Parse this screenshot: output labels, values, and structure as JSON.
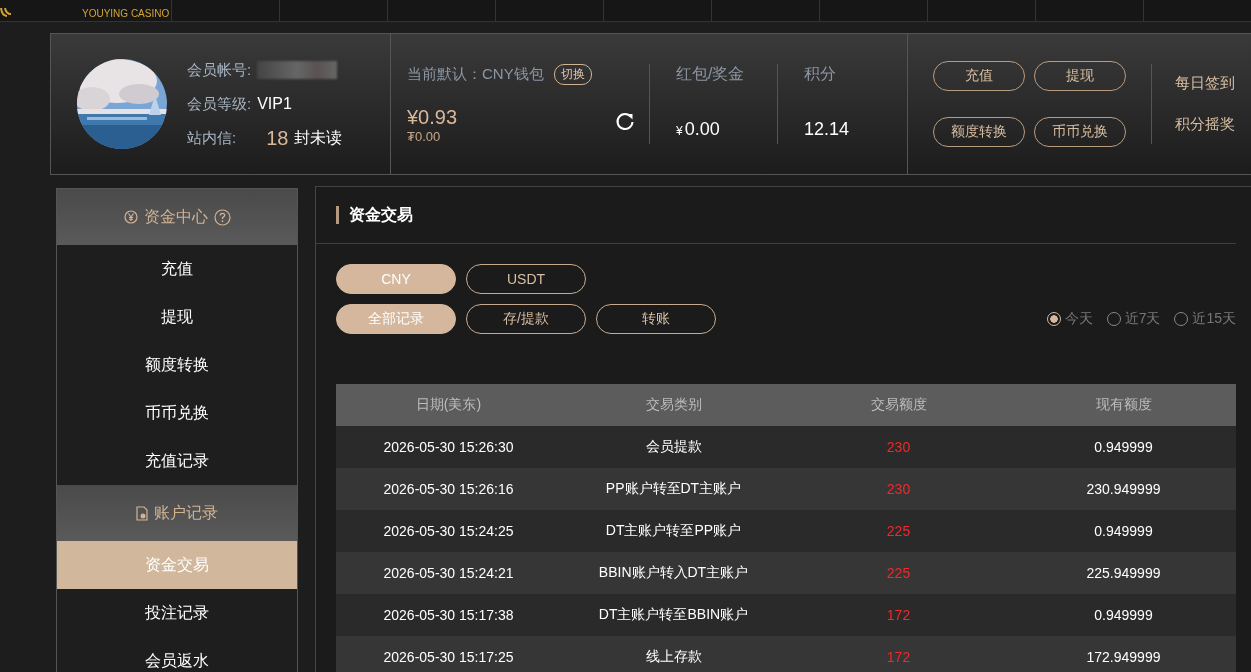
{
  "brand": {
    "name": "YOUYING CASINO"
  },
  "profile": {
    "account_label": "会员帐号:",
    "level_label": "会员等级:",
    "level": "VIP1",
    "mail_label": "站内信:",
    "mail_count": "18",
    "mail_suffix": "封未读"
  },
  "wallet": {
    "label": "当前默认：CNY钱包",
    "switch": "切换",
    "balance": "¥0.93",
    "usdt_balance": "₮0.00"
  },
  "bonus": {
    "label": "红包/奖金",
    "currency": "¥",
    "amount": "0.00"
  },
  "points": {
    "label": "积分",
    "amount": "12.14"
  },
  "quick_buttons": [
    "充值",
    "提现",
    "额度转换",
    "币币兑换"
  ],
  "extra_links": [
    "每日签到",
    "积分摇奖"
  ],
  "sidebar": [
    {
      "title": "资金中心",
      "kind": "funds",
      "items": [
        {
          "label": "充值",
          "selected": false
        },
        {
          "label": "提现",
          "selected": false
        },
        {
          "label": "额度转换",
          "selected": false
        },
        {
          "label": "币币兑换",
          "selected": false
        },
        {
          "label": "充值记录",
          "selected": false
        }
      ]
    },
    {
      "title": "账户记录",
      "kind": "records",
      "items": [
        {
          "label": "资金交易",
          "selected": true
        },
        {
          "label": "投注记录",
          "selected": false
        },
        {
          "label": "会员返水",
          "selected": false
        }
      ]
    }
  ],
  "panel": {
    "title": "资金交易"
  },
  "currency_tabs": [
    {
      "label": "CNY",
      "selected": true
    },
    {
      "label": "USDT",
      "selected": false
    }
  ],
  "type_tabs": [
    {
      "label": "全部记录",
      "selected": true
    },
    {
      "label": "存/提款",
      "selected": false
    },
    {
      "label": "转账",
      "selected": false
    }
  ],
  "periods": [
    {
      "label": "今天",
      "selected": true
    },
    {
      "label": "近7天",
      "selected": false
    },
    {
      "label": "近15天",
      "selected": false
    }
  ],
  "table": {
    "columns": [
      "日期(美东)",
      "交易类别",
      "交易额度",
      "现有额度"
    ],
    "rows": [
      [
        "2026-05-30 15:26:30",
        "会员提款",
        "230",
        "0.949999"
      ],
      [
        "2026-05-30 15:26:16",
        "PP账户转至DT主账户",
        "230",
        "230.949999"
      ],
      [
        "2026-05-30 15:24:25",
        "DT主账户转至PP账户",
        "225",
        "0.949999"
      ],
      [
        "2026-05-30 15:24:21",
        "BBIN账户转入DT主账户",
        "225",
        "225.949999"
      ],
      [
        "2026-05-30 15:17:38",
        "DT主账户转至BBIN账户",
        "172",
        "0.949999"
      ],
      [
        "2026-05-30 15:17:25",
        "线上存款",
        "172",
        "172.949999"
      ]
    ]
  }
}
